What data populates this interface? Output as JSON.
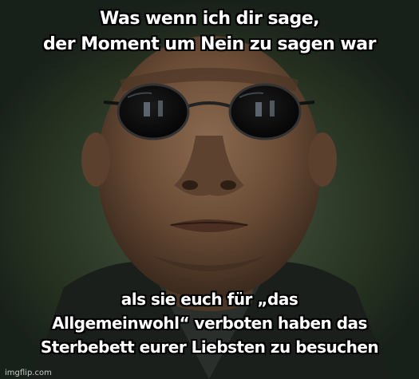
{
  "meme": {
    "top_text": [
      "Was wenn ich dir sage,",
      "der Moment um Nein zu sagen war"
    ],
    "bottom_text": [
      "als sie euch für „das",
      "Allgemeinwohl“ verboten haben das",
      "Sterbebett eurer Liebsten zu besuchen"
    ],
    "watermark": "imgflip.com"
  }
}
